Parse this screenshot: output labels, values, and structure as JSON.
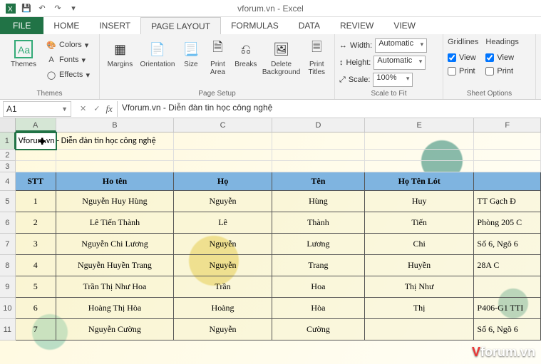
{
  "title": "vforum.vn - Excel",
  "tabs": {
    "file": "FILE",
    "home": "HOME",
    "insert": "INSERT",
    "pagelayout": "PAGE LAYOUT",
    "formulas": "FORMULAS",
    "data": "DATA",
    "review": "REVIEW",
    "view": "VIEW"
  },
  "ribbon": {
    "themes": {
      "label": "Themes",
      "themes": "Themes",
      "colors": "Colors",
      "fonts": "Fonts",
      "effects": "Effects"
    },
    "pagesetup": {
      "label": "Page Setup",
      "margins": "Margins",
      "orientation": "Orientation",
      "size": "Size",
      "printarea": "Print\nArea",
      "breaks": "Breaks",
      "deletebg": "Delete\nBackground",
      "printtitles": "Print\nTitles"
    },
    "scale": {
      "label": "Scale to Fit",
      "width": "Width:",
      "height": "Height:",
      "scale": "Scale:",
      "auto": "Automatic",
      "pct": "100%"
    },
    "sheet": {
      "label": "Sheet Options",
      "gridlines": "Gridlines",
      "headings": "Headings",
      "view": "View",
      "print": "Print"
    }
  },
  "namebox": "A1",
  "formula": "Vforum.vn - Diễn đàn tin học công nghệ",
  "cols": [
    "A",
    "B",
    "C",
    "D",
    "E",
    "F"
  ],
  "a1Display": "Vforum.vn - Diễn đàn tin học công nghệ",
  "a1InCell": "Vforu      n",
  "headers": {
    "a": "STT",
    "b": "Ho tên",
    "c": "Họ",
    "d": "Tên",
    "e": "Họ Tên Lót",
    "f": ""
  },
  "rows": [
    {
      "n": "5",
      "a": "1",
      "b": "Nguyễn Huy Hùng",
      "c": "Nguyễn",
      "d": "Hùng",
      "e": "Huy",
      "f": "TT Gạch Đ"
    },
    {
      "n": "6",
      "a": "2",
      "b": "Lê Tiến Thành",
      "c": "Lê",
      "d": "Thành",
      "e": "Tiến",
      "f": "Phòng 205 C"
    },
    {
      "n": "7",
      "a": "3",
      "b": "Nguyễn Chi Lương",
      "c": "Nguyễn",
      "d": "Lương",
      "e": "Chi",
      "f": "Số 6, Ngô 6"
    },
    {
      "n": "8",
      "a": "4",
      "b": "Nguyễn Huyền Trang",
      "c": "Nguyễn",
      "d": "Trang",
      "e": "Huyền",
      "f": "28A C"
    },
    {
      "n": "9",
      "a": "5",
      "b": "Trần Thị Như Hoa",
      "c": "Trần",
      "d": "Hoa",
      "e": "Thị Như",
      "f": ""
    },
    {
      "n": "10",
      "a": "6",
      "b": "Hoàng Thị Hòa",
      "c": "Hoàng",
      "d": "Hòa",
      "e": "Thị",
      "f": "P406-G1 TTI"
    },
    {
      "n": "11",
      "a": "7",
      "b": "Nguyễn  Cường",
      "c": "Nguyễn",
      "d": "Cường",
      "e": "",
      "f": "Số 6, Ngõ 6"
    }
  ],
  "watermark": {
    "v": "V",
    "rest": "forum.vn"
  }
}
